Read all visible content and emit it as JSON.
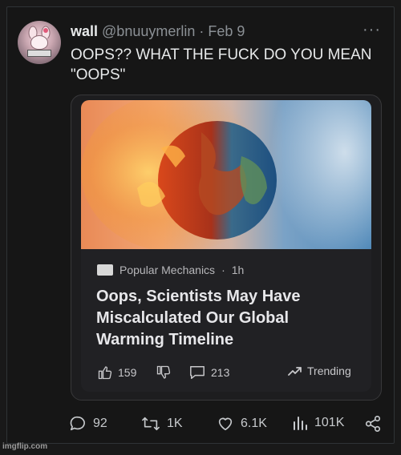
{
  "tweet": {
    "display_name": "wall",
    "handle": "@bnuuymerlin",
    "separator": "·",
    "date": "Feb 9",
    "text_line1": "OOPS?? WHAT THE FUCK DO YOU MEAN",
    "text_line2": "\"OOPS\""
  },
  "card": {
    "publisher": "Popular Mechanics",
    "time": "1h",
    "meta_separator": "·",
    "headline": "Oops, Scientists May Have Miscalculated Our Global Warming Timeline",
    "likes": "159",
    "comments": "213",
    "trending_label": "Trending"
  },
  "actions": {
    "replies": "92",
    "reposts": "1K",
    "likes": "6.1K",
    "views": "101K"
  },
  "watermark": "imgflip.com",
  "colors": {
    "background": "#191919",
    "text": "#e7e9ea",
    "muted": "#8b9095"
  }
}
